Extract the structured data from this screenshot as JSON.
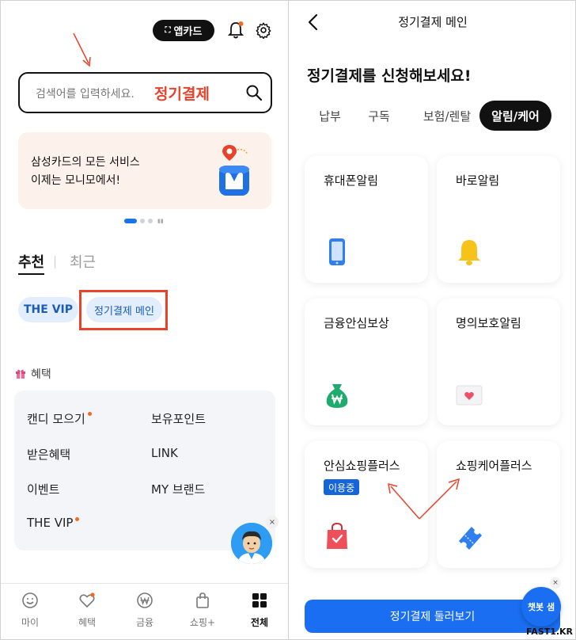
{
  "left": {
    "header": {
      "appcard_label": "앱카드"
    },
    "search": {
      "placeholder": "검색어를 입력하세요.",
      "highlight": "정기결제"
    },
    "banner": {
      "line1": "삼성카드의 모든 서비스",
      "line2": "이제는 모니모에서!"
    },
    "tabs": {
      "recommended": "추천",
      "recent": "최근"
    },
    "chips": [
      "THE VIP",
      "정기결제 메인"
    ],
    "benefits": {
      "title": "혜택",
      "items": [
        {
          "label": "캔디 모으기",
          "new": true
        },
        {
          "label": "보유포인트",
          "new": false
        },
        {
          "label": "받은혜택",
          "new": false
        },
        {
          "label": "LINK",
          "new": false
        },
        {
          "label": "이벤트",
          "new": false
        },
        {
          "label": "MY 브랜드",
          "new": false
        },
        {
          "label": "THE VIP",
          "new": true
        }
      ]
    },
    "bottom_nav": [
      {
        "label": "마이",
        "icon": "smile-icon"
      },
      {
        "label": "혜택",
        "icon": "heart-icon"
      },
      {
        "label": "금융",
        "icon": "won-icon"
      },
      {
        "label": "쇼핑+",
        "icon": "shopping-bag-icon"
      },
      {
        "label": "전체",
        "icon": "grid-icon",
        "active": true
      }
    ],
    "close_glyph": "×"
  },
  "right": {
    "title": "정기결제 메인",
    "headline": "정기결제를 신청해보세요!",
    "tabs": [
      {
        "label": "납부",
        "active": false
      },
      {
        "label": "구독",
        "active": false
      },
      {
        "label": "보험/렌탈",
        "active": false
      },
      {
        "label": "알림/케어",
        "active": true
      }
    ],
    "cards": [
      {
        "title": "휴대폰알림",
        "icon": "phone-icon"
      },
      {
        "title": "바로알림",
        "icon": "bell-icon"
      },
      {
        "title": "금융안심보상",
        "icon": "money-bag-icon"
      },
      {
        "title": "명의보호알림",
        "icon": "heart-card-icon"
      },
      {
        "title": "안심쇼핑플러스",
        "icon": "shopping-bag-check-icon",
        "badge": "이용중"
      },
      {
        "title": "쇼핑케어플러스",
        "icon": "ticket-icon"
      }
    ],
    "cta": "정기결제 둘러보기",
    "chatbot": "챗봇 샘",
    "watermark": "FAST1.KR",
    "close_glyph": "×"
  },
  "colors": {
    "brand_blue": "#1a6ef2",
    "annotation_red": "#e8422b",
    "banner_bg": "#fdf1ec"
  }
}
